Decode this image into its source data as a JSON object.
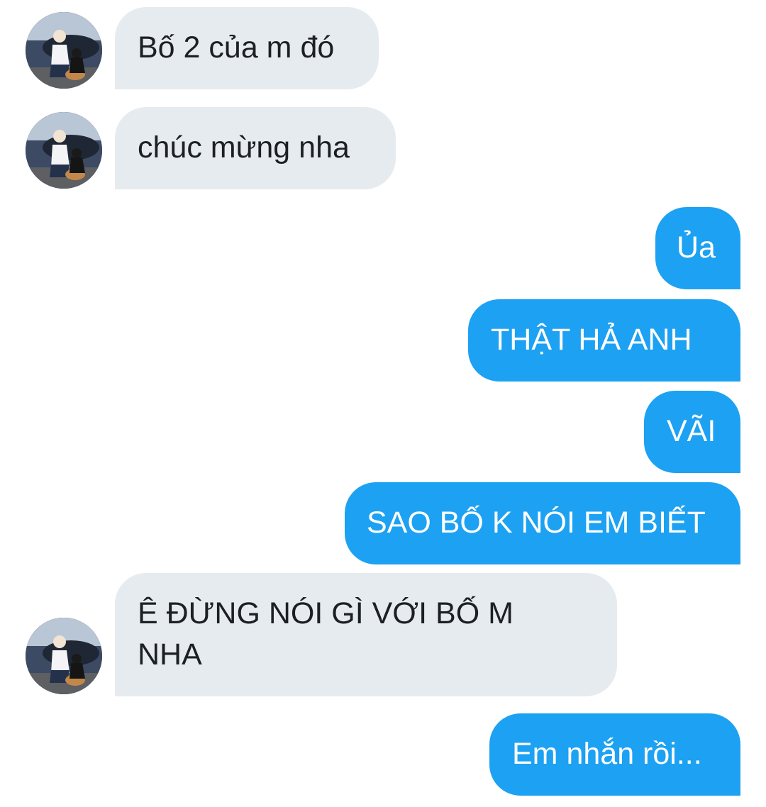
{
  "conversation": {
    "messages": [
      {
        "direction": "incoming",
        "text": "Bố 2 của m đó"
      },
      {
        "direction": "incoming",
        "text": "chúc mừng nha"
      },
      {
        "direction": "outgoing",
        "text": "Ủa"
      },
      {
        "direction": "outgoing",
        "text": "THẬT HẢ ANH"
      },
      {
        "direction": "outgoing",
        "text": "VÃI"
      },
      {
        "direction": "outgoing",
        "text": "SAO BỐ K NÓI EM BIẾT"
      },
      {
        "direction": "incoming",
        "text": "Ê ĐỪNG NÓI GÌ VỚI BỐ M",
        "text_line2": "NHA"
      },
      {
        "direction": "outgoing",
        "text": "Em nhắn rồi..."
      }
    ]
  },
  "colors": {
    "incoming_bubble": "#e6ebef",
    "outgoing_bubble": "#1da1f2",
    "incoming_text": "#1c2024",
    "outgoing_text": "#ffffff"
  },
  "icons": {
    "sender_avatar": "sender-avatar-photo"
  }
}
